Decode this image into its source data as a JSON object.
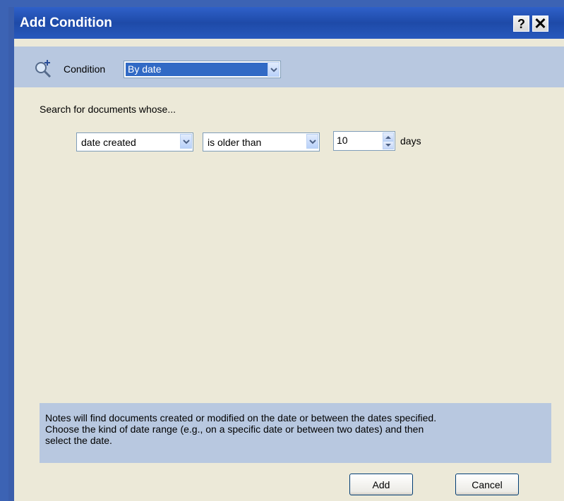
{
  "window": {
    "title": "Add Condition",
    "help_label": "?",
    "close_label": "✕"
  },
  "condition": {
    "label": "Condition",
    "selected": "By date",
    "icon": "search-add-icon"
  },
  "criteria": {
    "intro": "Search for documents whose...",
    "field_selected": "date created",
    "operator_selected": "is older than",
    "amount": "10",
    "unit": "days"
  },
  "notes": {
    "lines": [
      "Notes will find documents created or modified on the date or between the dates specified.",
      "Choose the kind of date range (e.g., on a specific date or between two dates) and then",
      "select the date."
    ]
  },
  "buttons": {
    "add": "Add",
    "cancel": "Cancel"
  },
  "colors": {
    "titlebar": "#2456b8",
    "panel": "#b8c8e0",
    "dialog_bg": "#ece9d8",
    "selection": "#316ac5"
  }
}
